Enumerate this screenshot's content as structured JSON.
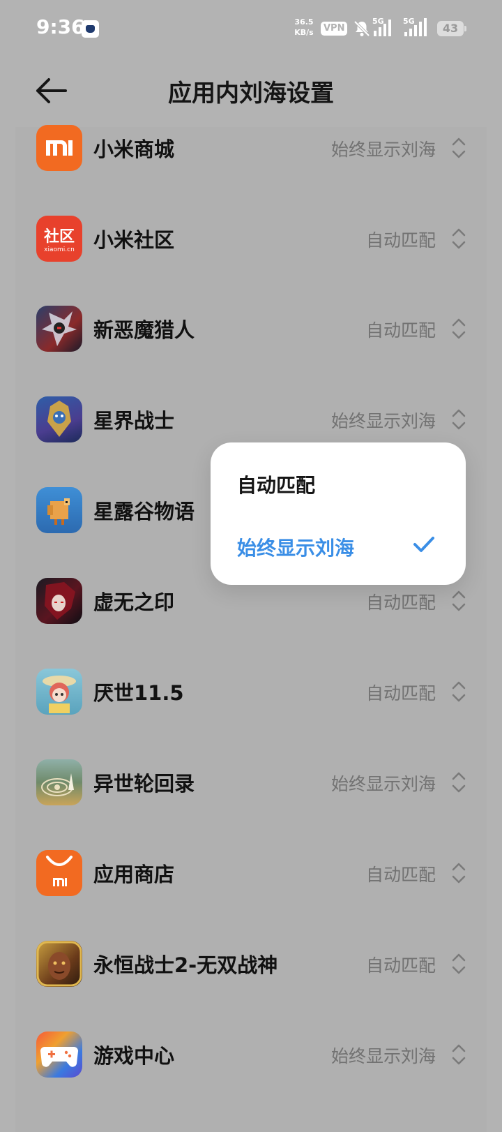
{
  "status_bar": {
    "time": "9:36",
    "speed_value": "36.5",
    "speed_unit": "KB/s",
    "vpn": "VPN",
    "sim1": "5G",
    "sim2": "5G",
    "battery": "43"
  },
  "header": {
    "title": "应用内刘海设置"
  },
  "apps": [
    {
      "name": "小米商城",
      "mode": "始终显示刘海",
      "icon_text": "mi"
    },
    {
      "name": "小米社区",
      "mode": "自动匹配",
      "icon_text": "社区",
      "icon_subtext": "xiaomi.cn"
    },
    {
      "name": "新恶魔猎人",
      "mode": "自动匹配"
    },
    {
      "name": "星界战士",
      "mode": "始终显示刘海"
    },
    {
      "name": "星露谷物语",
      "mode": "始终显示刘海"
    },
    {
      "name": "虚无之印",
      "mode": "自动匹配"
    },
    {
      "name": "厌世11.5",
      "mode": "自动匹配"
    },
    {
      "name": "异世轮回录",
      "mode": "始终显示刘海"
    },
    {
      "name": "应用商店",
      "mode": "自动匹配",
      "icon_text": "mi"
    },
    {
      "name": "永恒战士2-无双战神",
      "mode": "自动匹配"
    },
    {
      "name": "游戏中心",
      "mode": "始终显示刘海"
    }
  ],
  "popup": {
    "options": [
      "自动匹配",
      "始终显示刘海"
    ],
    "selected": "始终显示刘海"
  },
  "colors": {
    "accent": "#3a8ee6",
    "scrim": "#b3b3b3"
  }
}
